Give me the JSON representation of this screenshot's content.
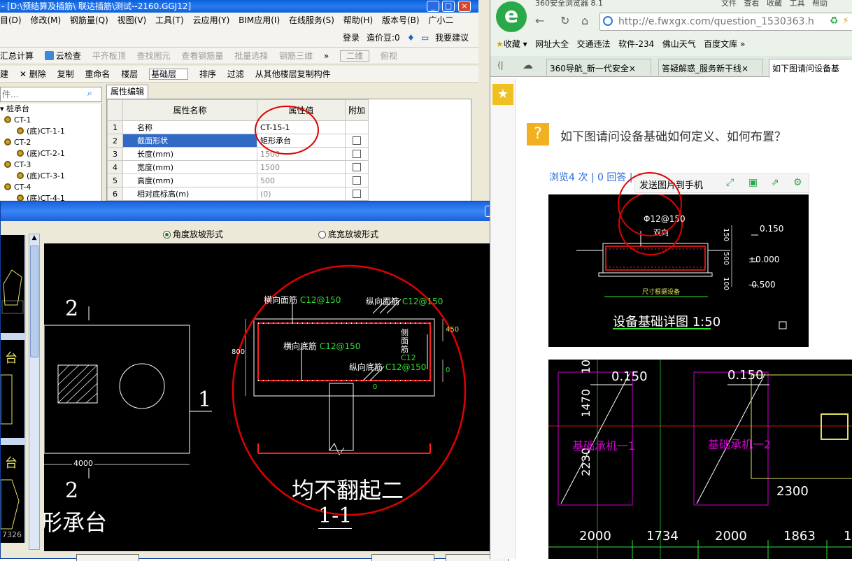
{
  "app": {
    "title": "- [D:\\预结算及插筋\\ 联达插筋\\测试--2160.GGJ12]",
    "menu": [
      "目(D)",
      "修改(M)",
      "钢筋量(Q)",
      "视图(V)",
      "工具(T)",
      "云应用(Y)",
      "BIM应用(I)",
      "在线服务(S)",
      "帮助(H)",
      "版本号(B)",
      "广小二"
    ],
    "login": "登录",
    "price": "造价豆:0",
    "suggest": "我要建议",
    "toolbar1": [
      "汇总计算",
      "云检查",
      "平齐板顶",
      "查找图元",
      "查看钢筋量",
      "批量选择",
      "钢筋三维"
    ],
    "view2d": "二维",
    "viewTop": "俯视",
    "toolbar2": [
      "建",
      "删除",
      "复制",
      "重命名",
      "楼层"
    ],
    "floor": "基础层",
    "toolbar2b": [
      "排序",
      "过滤",
      "从其他楼层复制构件"
    ],
    "search_placeholder": "件...",
    "tree": {
      "root": "桩承台",
      "items": [
        "CT-1",
        "(底)CT-1-1",
        "CT-2",
        "(底)CT-2-1",
        "CT-3",
        "(底)CT-3-1",
        "CT-4",
        "(底)CT-4-1"
      ]
    },
    "prop_tab": "属性编辑",
    "prop_headers": [
      "属性名称",
      "属性值",
      "附加"
    ],
    "props": [
      {
        "n": "1",
        "name": "名称",
        "value": "CT-15-1",
        "extra": false
      },
      {
        "n": "2",
        "name": "截面形状",
        "value": "矩形承台",
        "extra": true
      },
      {
        "n": "3",
        "name": "长度(mm)",
        "value": "1500",
        "extra": true
      },
      {
        "n": "4",
        "name": "宽度(mm)",
        "value": "1500",
        "extra": true
      },
      {
        "n": "5",
        "name": "高度(mm)",
        "value": "500",
        "extra": true
      },
      {
        "n": "6",
        "name": "相对底标高(m)",
        "value": "(0)",
        "extra": true
      }
    ]
  },
  "dialog": {
    "radio1": "角度放坡形式",
    "radio2": "底宽放坡形式",
    "plan": {
      "label2top": "2",
      "label1": "1",
      "label2bot": "2",
      "dim": "4000",
      "caption": "形承台",
      "thumb_num": "7326",
      "thumb_t1": "台",
      "thumb_t2": "台"
    },
    "section": {
      "heng_mian": "横向面筋",
      "heng_mian_v": "C12@150",
      "zong_mian": "纵向面筋",
      "zong_mian_v": "C12@150",
      "heng_di": "横向底筋",
      "heng_di_v": "C12@150",
      "zong_di": "纵向底筋",
      "zong_di_v": "C12@150",
      "side": "侧面筋",
      "side_v": "C12",
      "d800": "800",
      "d450": "450",
      "d0": "0",
      "note": "均不翻起二",
      "caption": "1-1"
    }
  },
  "browser": {
    "title_tabs": [
      "360安全浏览器 8.1",
      "文件",
      "查看",
      "收藏",
      "工具",
      "帮助"
    ],
    "url": "http://e.fwxgx.com/question_1530363.h",
    "bookmarks": [
      "收藏",
      "网址大全",
      "交通违法",
      "软件-234",
      "佛山天气",
      "百度文库"
    ],
    "tabs": [
      "360导航_新一代安全",
      "答疑解惑_服务新干线",
      "如下图请问设备基"
    ],
    "question": "如下图请问设备基础如何定义、如何布置？",
    "stats": "浏览4 次 | 0 回答 | 0 ",
    "send_phone": "发送图片到手机",
    "img1": {
      "rebar": "Φ12@150",
      "dir": "双向",
      "e1": "0.150",
      "e2": "±0.000",
      "e3": "-0.500",
      "d150": "150",
      "d500": "500",
      "d100": "100",
      "foot": "尺寸根据设备",
      "caption": "设备基础详图 1:50"
    },
    "img2": {
      "e1": "0.150",
      "e2": "0.150",
      "v1": "1470",
      "v2": "2230",
      "v3": "10",
      "lab1": "基础承机一1",
      "lab2": "基础承机一2",
      "d2300": "2300",
      "dims": [
        "2000",
        "1734",
        "2000",
        "1863",
        "1"
      ]
    }
  },
  "colors": {
    "title_blue": "#0a5fd8",
    "red_circle": "#e00000",
    "cad_green": "#33e033",
    "cad_magenta": "#d000d0"
  }
}
